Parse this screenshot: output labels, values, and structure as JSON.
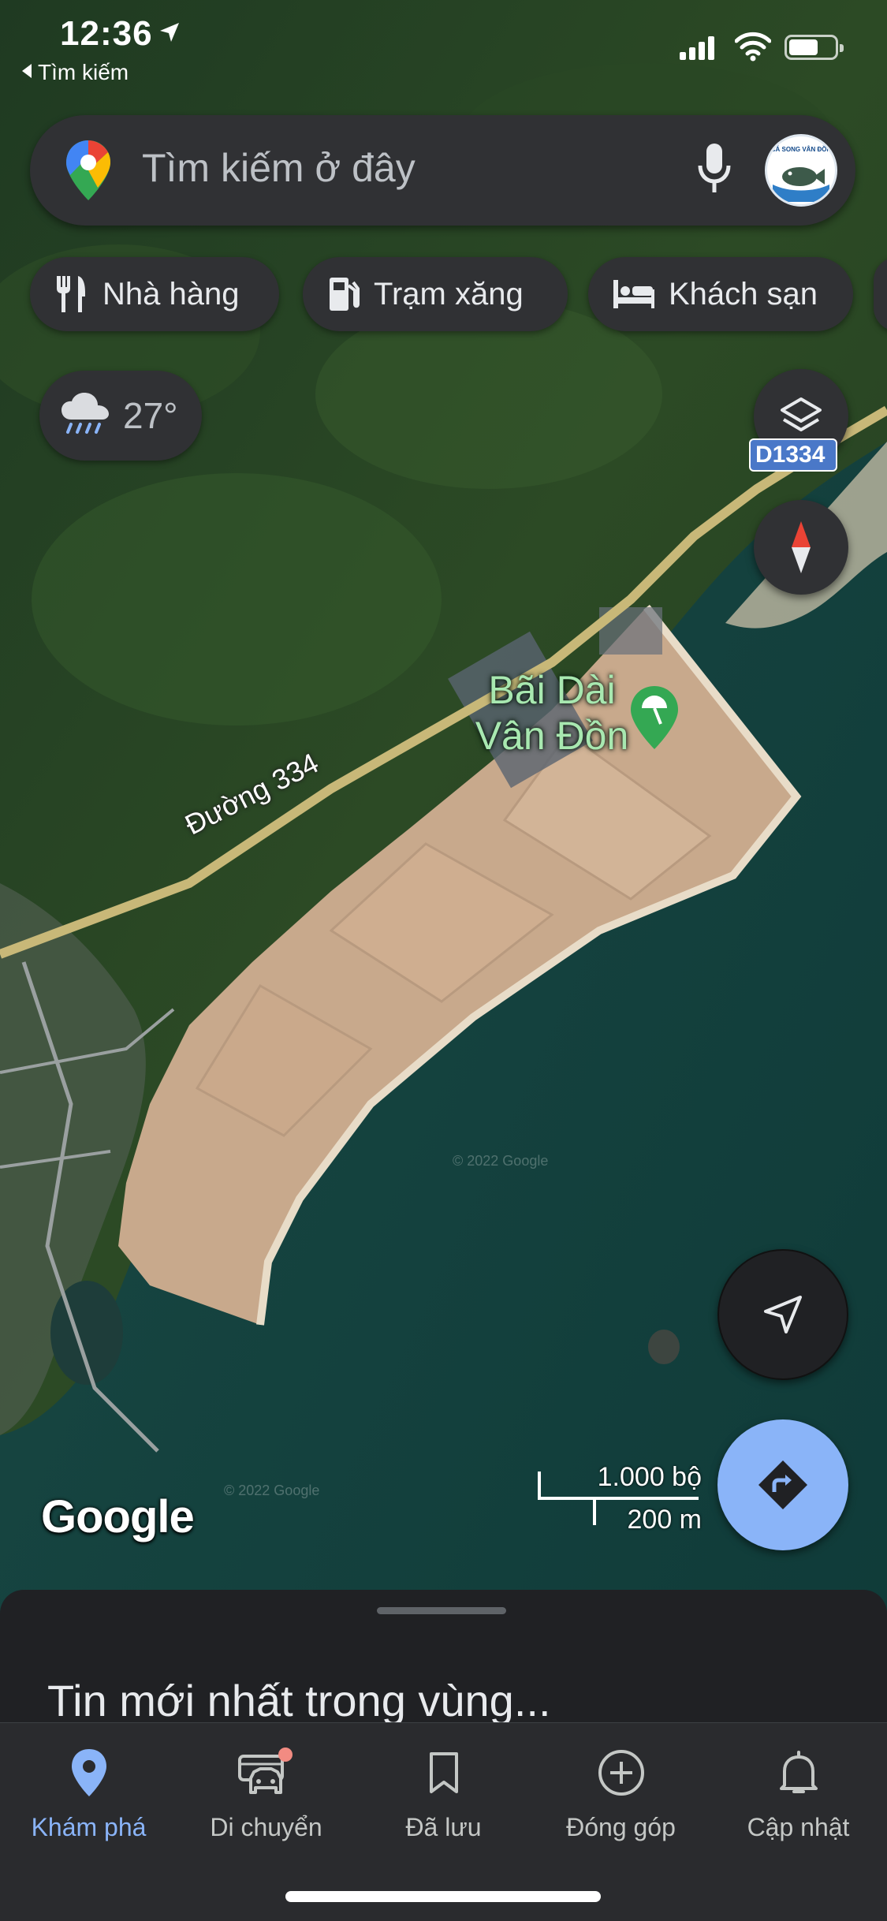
{
  "status_bar": {
    "time": "12:36",
    "back_app_label": "Tìm kiếm"
  },
  "search": {
    "placeholder": "Tìm kiếm ở đây",
    "avatar_text": "CÁ SONG VÂN ĐỒN"
  },
  "chips": [
    {
      "label": "Nhà hàng",
      "icon": "restaurant-icon"
    },
    {
      "label": "Trạm xăng",
      "icon": "gas-station-icon"
    },
    {
      "label": "Khách sạn",
      "icon": "hotel-icon"
    }
  ],
  "weather": {
    "temperature": "27°",
    "icon": "rain-cloud-icon"
  },
  "map": {
    "place_line1": "Bãi Dài",
    "place_line2": "Vân Đồn",
    "road_label": "Đường 334",
    "route_shield": "D1334",
    "copyright": "© 2022 Google",
    "logo": "Google",
    "scale_top": "1.000 bộ",
    "scale_bottom": "200 m"
  },
  "sheet": {
    "headline": "Tin mới nhất trong vùng..."
  },
  "tabs": [
    {
      "label": "Khám phá",
      "icon": "location-pin-icon",
      "active": true
    },
    {
      "label": "Di chuyển",
      "icon": "car-icon",
      "badge": true
    },
    {
      "label": "Đã lưu",
      "icon": "bookmark-icon"
    },
    {
      "label": "Đóng góp",
      "icon": "add-circle-icon"
    },
    {
      "label": "Cập nhật",
      "icon": "bell-icon"
    }
  ],
  "colors": {
    "accent": "#8ab4f8",
    "surface": "#303134",
    "sheet": "#202124",
    "place_label": "#a8e8b0"
  }
}
